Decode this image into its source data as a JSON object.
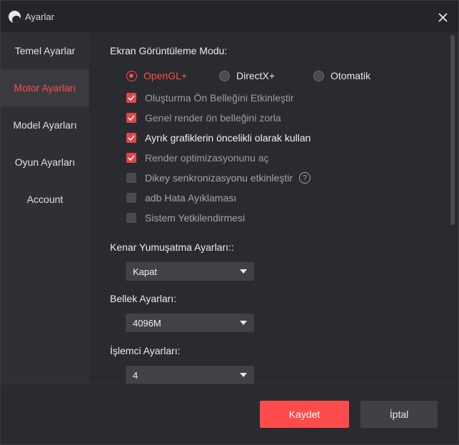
{
  "window": {
    "title": "Ayarlar"
  },
  "sidebar": {
    "items": [
      {
        "label": "Temel Ayarlar",
        "active": false
      },
      {
        "label": "Motor Ayarları",
        "active": true
      },
      {
        "label": "Model Ayarları",
        "active": false
      },
      {
        "label": "Oyun Ayarları",
        "active": false
      },
      {
        "label": "Account",
        "active": false
      }
    ]
  },
  "engine": {
    "display_mode_heading": "Ekran Görüntüleme Modu:",
    "render_modes": [
      {
        "label": "OpenGL+",
        "selected": true
      },
      {
        "label": "DirectX+",
        "selected": false
      },
      {
        "label": "Otomatik",
        "selected": false
      }
    ],
    "options": [
      {
        "label": "Oluşturma Ön Belleğini Etkinleştir",
        "checked": true
      },
      {
        "label": "Genel render ön belleğini zorla",
        "checked": true
      },
      {
        "label": "Ayrık grafiklerin öncelikli olarak kullan",
        "checked": true
      },
      {
        "label": "Render optimizasyonunu aç",
        "checked": true
      },
      {
        "label": "Dikey senkronizasyonu etkinleştir",
        "checked": false,
        "help": "?"
      },
      {
        "label": "adb Hata Ayıklaması",
        "checked": false
      },
      {
        "label": "Sistem Yetkilendirmesi",
        "checked": false
      }
    ],
    "antialias": {
      "heading": "Kenar Yumuşatma Ayarları::",
      "value": "Kapat"
    },
    "memory": {
      "heading": "Bellek Ayarları:",
      "value": "4096M"
    },
    "cpu": {
      "heading": "İşlemci Ayarları:",
      "value": "4"
    }
  },
  "footer": {
    "save_label": "Kaydet",
    "cancel_label": "İptal"
  },
  "colors": {
    "accent": "#ff4b4b",
    "background": "#2a2b30",
    "sidebar": "#2f3035"
  },
  "icons": {
    "logo": "app-logo-icon",
    "close": "close-icon",
    "check": "check-icon",
    "caret": "chevron-down-icon",
    "help": "help-icon"
  }
}
